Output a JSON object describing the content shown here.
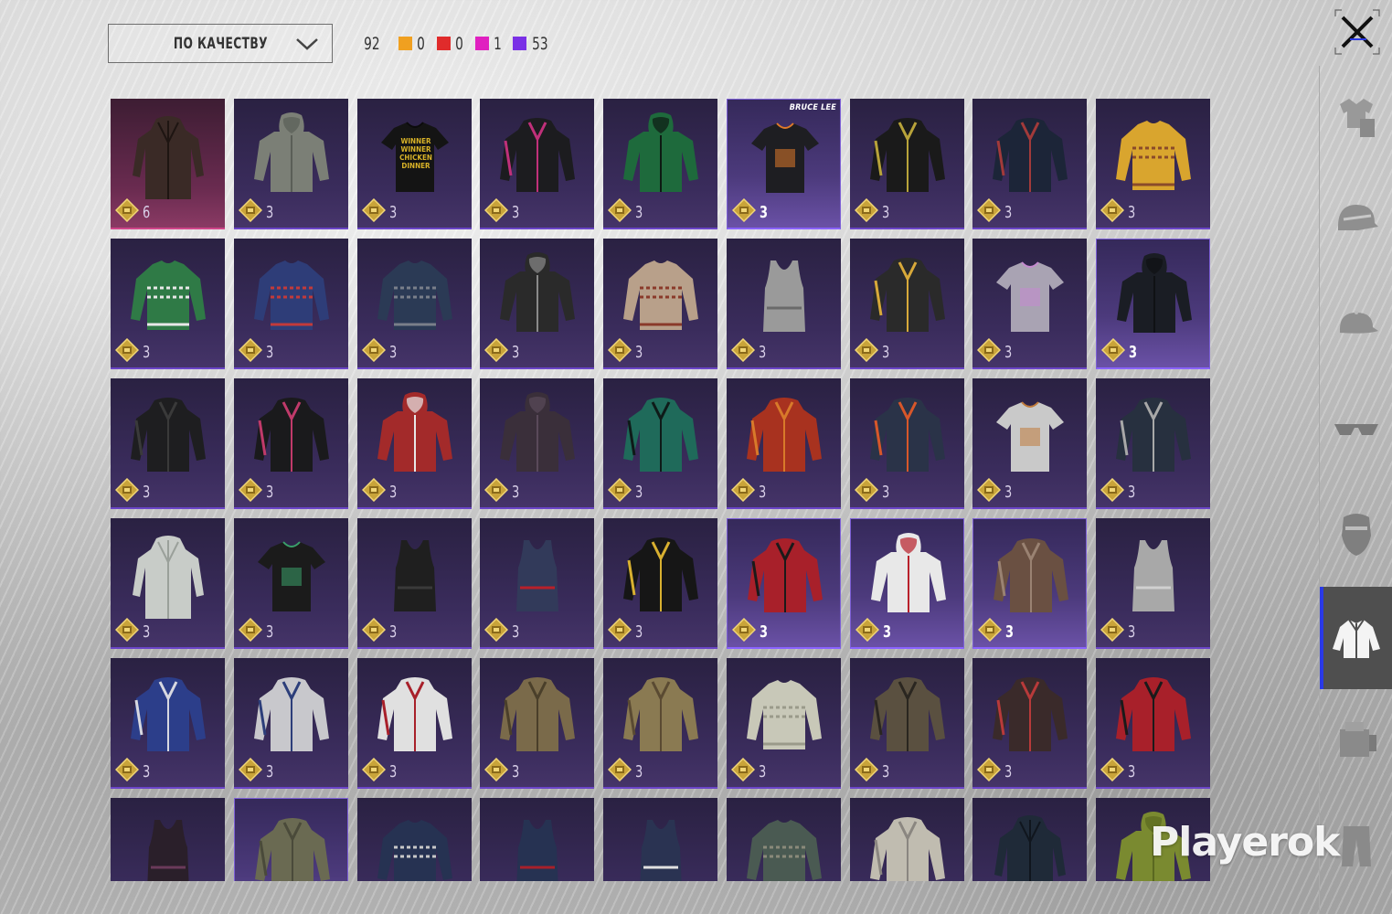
{
  "toolbar": {
    "sort_label": "ПО КАЧЕСТВУ",
    "total_count": "92",
    "rarity_counts": [
      {
        "color": "#f0a020",
        "count": "0"
      },
      {
        "color": "#e02b2b",
        "count": "0"
      },
      {
        "color": "#e020c0",
        "count": "1"
      },
      {
        "color": "#7a30e6",
        "count": "53"
      }
    ]
  },
  "sidebar": {
    "active_index": 5,
    "categories": [
      {
        "icon": "outfit-icon"
      },
      {
        "icon": "helmet-icon"
      },
      {
        "icon": "cap-icon"
      },
      {
        "icon": "glasses-icon"
      },
      {
        "icon": "mask-icon"
      },
      {
        "icon": "jacket-icon"
      },
      {
        "icon": "gloves-icon"
      },
      {
        "icon": "pants-icon"
      }
    ]
  },
  "colors": {
    "accent": "#2a39e6",
    "epic": "#7a30e6",
    "mythic": "#d0468a"
  },
  "items": [
    {
      "qty": "6",
      "kind": "coat",
      "c1": "#3a2a26",
      "c2": "#1e1512",
      "style": "first"
    },
    {
      "qty": "3",
      "kind": "hoodie",
      "c1": "#7b7f76",
      "c2": "#5a5e57"
    },
    {
      "qty": "3",
      "kind": "tshirt",
      "c1": "#141414",
      "c2": "#0b0b0b",
      "text": "WINNER WINNER CHICKEN DINNER"
    },
    {
      "qty": "3",
      "kind": "jacket",
      "c1": "#1c1c1f",
      "c2": "#c0307a"
    },
    {
      "qty": "3",
      "kind": "hoodie",
      "c1": "#1e6a3c",
      "c2": "#0d1a12"
    },
    {
      "qty": "3",
      "kind": "tshirt",
      "c1": "#1e1e22",
      "c2": "#e07a2a",
      "style": "hl",
      "brand": "BRUCE LEE"
    },
    {
      "qty": "3",
      "kind": "jacket",
      "c1": "#1a1a1a",
      "c2": "#b8a33a"
    },
    {
      "qty": "3",
      "kind": "jacket",
      "c1": "#1c2538",
      "c2": "#a23a3a"
    },
    {
      "qty": "3",
      "kind": "sweater",
      "c1": "#d9a52e",
      "c2": "#8a4b2a"
    },
    {
      "qty": "3",
      "kind": "sweater",
      "c1": "#2f7a46",
      "c2": "#e8e8e8"
    },
    {
      "qty": "3",
      "kind": "sweater",
      "c1": "#2e3d78",
      "c2": "#c23a3a"
    },
    {
      "qty": "3",
      "kind": "sweater",
      "c1": "#2b3a55",
      "c2": "#7a7f8a"
    },
    {
      "qty": "3",
      "kind": "hoodie",
      "c1": "#2a2a2a",
      "c2": "#8a8a8a"
    },
    {
      "qty": "3",
      "kind": "sweater",
      "c1": "#b8a08a",
      "c2": "#8a3a2a"
    },
    {
      "qty": "3",
      "kind": "tank",
      "c1": "#9a9a9a",
      "c2": "#6a6a6a"
    },
    {
      "qty": "3",
      "kind": "jacket",
      "c1": "#2a2a2a",
      "c2": "#d8a93a"
    },
    {
      "qty": "3",
      "kind": "tshirt",
      "c1": "#a9a3b3",
      "c2": "#c58ad0"
    },
    {
      "qty": "3",
      "kind": "hoodie",
      "c1": "#1a1d24",
      "c2": "#0f1114",
      "style": "hl"
    },
    {
      "qty": "3",
      "kind": "jacket",
      "c1": "#1e1e20",
      "c2": "#3a3a3a"
    },
    {
      "qty": "3",
      "kind": "jacket",
      "c1": "#1a1a1c",
      "c2": "#c03a6a"
    },
    {
      "qty": "3",
      "kind": "hoodie",
      "c1": "#a32a2a",
      "c2": "#e8e8e8"
    },
    {
      "qty": "3",
      "kind": "hoodie",
      "c1": "#3a2f3a",
      "c2": "#5a4a5a"
    },
    {
      "qty": "3",
      "kind": "jacket",
      "c1": "#1f6a5a",
      "c2": "#0e1a18"
    },
    {
      "qty": "3",
      "kind": "jacket",
      "c1": "#a8321f",
      "c2": "#d87a2a"
    },
    {
      "qty": "3",
      "kind": "jacket",
      "c1": "#2a3348",
      "c2": "#d8572a"
    },
    {
      "qty": "3",
      "kind": "tshirt",
      "c1": "#c9c9c9",
      "c2": "#c07a3a"
    },
    {
      "qty": "3",
      "kind": "jacket",
      "c1": "#27303f",
      "c2": "#a8a8a8"
    },
    {
      "qty": "3",
      "kind": "coat",
      "c1": "#c8ccc8",
      "c2": "#9aa09a"
    },
    {
      "qty": "3",
      "kind": "tshirt",
      "c1": "#1b1b1b",
      "c2": "#3aa06a"
    },
    {
      "qty": "3",
      "kind": "tank",
      "c1": "#1f1f1f",
      "c2": "#3a3a3a"
    },
    {
      "qty": "3",
      "kind": "tank",
      "c1": "#323a5a",
      "c2": "#b8202a"
    },
    {
      "qty": "3",
      "kind": "jacket",
      "c1": "#161616",
      "c2": "#d8b030"
    },
    {
      "qty": "3",
      "kind": "jacket",
      "c1": "#a8202a",
      "c2": "#1a1a1a",
      "style": "hl"
    },
    {
      "qty": "3",
      "kind": "hoodie",
      "c1": "#e8e8e8",
      "c2": "#b8202a",
      "style": "hl"
    },
    {
      "qty": "3",
      "kind": "jacket",
      "c1": "#6a5042",
      "c2": "#9a8272",
      "style": "hl"
    },
    {
      "qty": "3",
      "kind": "tank",
      "c1": "#a8a8a8",
      "c2": "#d0d0d0"
    },
    {
      "qty": "3",
      "kind": "jacket",
      "c1": "#2c3e8a",
      "c2": "#d8d8e0"
    },
    {
      "qty": "3",
      "kind": "jacket",
      "c1": "#c8c8cc",
      "c2": "#2c3e7a"
    },
    {
      "qty": "3",
      "kind": "jacket",
      "c1": "#e0e0e0",
      "c2": "#a8202a"
    },
    {
      "qty": "3",
      "kind": "jacket",
      "c1": "#7a6a4a",
      "c2": "#4a3f2a"
    },
    {
      "qty": "3",
      "kind": "jacket",
      "c1": "#8a7a52",
      "c2": "#5a4a32"
    },
    {
      "qty": "3",
      "kind": "sweater",
      "c1": "#c8c8b8",
      "c2": "#9a9a8a"
    },
    {
      "qty": "3",
      "kind": "jacket",
      "c1": "#5a5040",
      "c2": "#2a2620"
    },
    {
      "qty": "3",
      "kind": "jacket",
      "c1": "#3a2a2a",
      "c2": "#b83a3a"
    },
    {
      "qty": "3",
      "kind": "jacket",
      "c1": "#a8202a",
      "c2": "#1a1a1a"
    },
    {
      "qty": "",
      "kind": "tank",
      "c1": "#2a1f2a",
      "c2": "#6a3a5a"
    },
    {
      "qty": "",
      "kind": "jacket",
      "c1": "#6a6a52",
      "c2": "#4a4a3a",
      "style": "hl"
    },
    {
      "qty": "",
      "kind": "sweater",
      "c1": "#263252",
      "c2": "#c8c8c8"
    },
    {
      "qty": "",
      "kind": "tank",
      "c1": "#263252",
      "c2": "#a8202a"
    },
    {
      "qty": "",
      "kind": "tank",
      "c1": "#2a3352",
      "c2": "#e0e0e0"
    },
    {
      "qty": "",
      "kind": "sweater",
      "c1": "#4a5a52",
      "c2": "#8a8a7a"
    },
    {
      "qty": "",
      "kind": "jacket",
      "c1": "#c0bcb0",
      "c2": "#8a8680"
    },
    {
      "qty": "",
      "kind": "coat",
      "c1": "#1f2a38",
      "c2": "#10161e"
    },
    {
      "qty": "",
      "kind": "hoodie",
      "c1": "#7a8a30",
      "c2": "#5a6820"
    }
  ],
  "watermark": "Playerok"
}
